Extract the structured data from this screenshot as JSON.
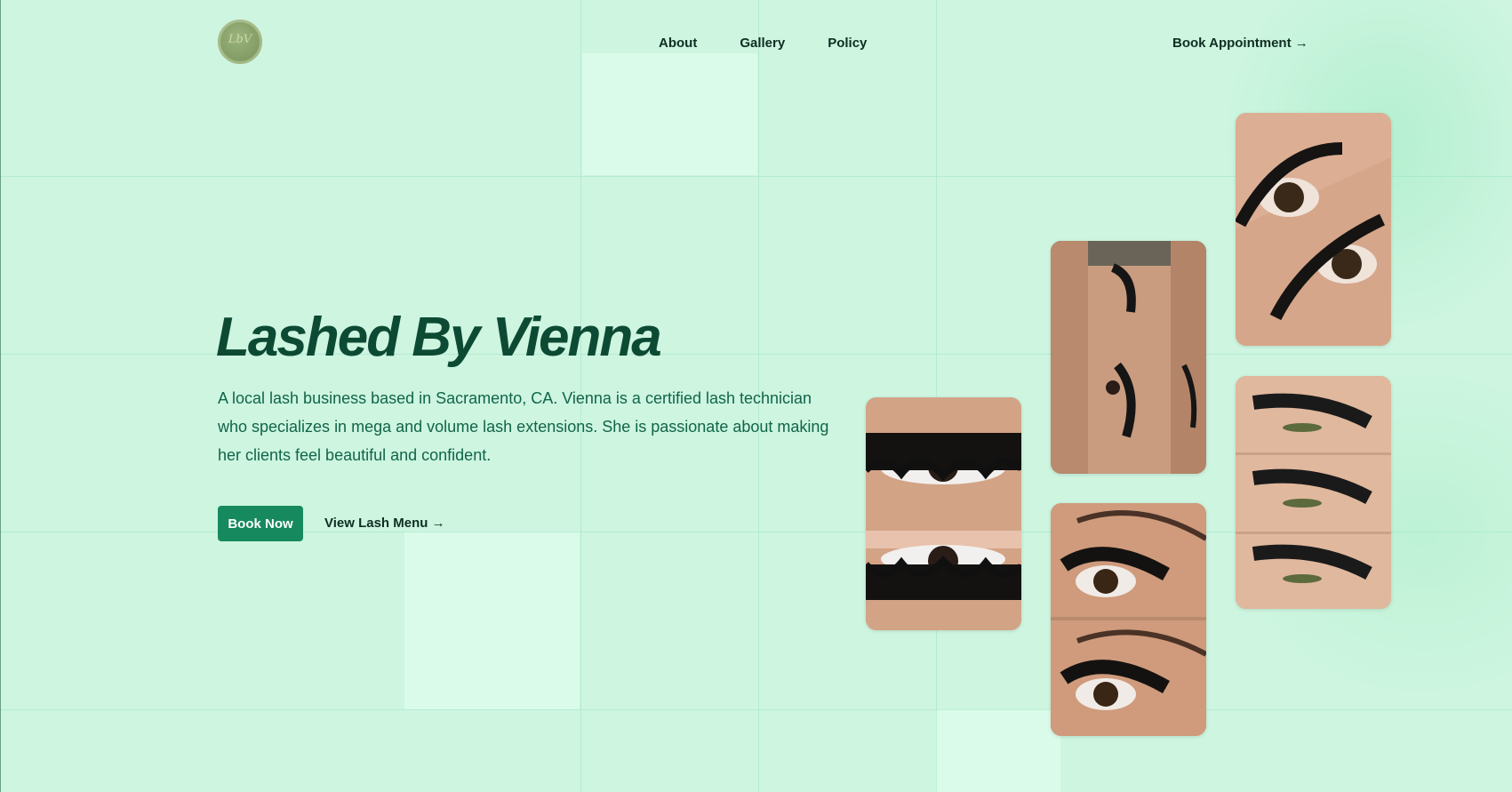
{
  "brand": {
    "logo_text": "LbV",
    "logo_icon": "circular-seal-logo"
  },
  "nav": {
    "items": [
      {
        "label": "About"
      },
      {
        "label": "Gallery"
      },
      {
        "label": "Policy"
      }
    ],
    "cta_label": "Book Appointment →"
  },
  "hero": {
    "title": "Lashed By Vienna",
    "description": "A local lash business based in Sacramento, CA. Vienna is a certified lash technician who specializes in mega and volume lash extensions. She is passionate about making her clients feel beautiful and confident.",
    "primary_button": "Book Now",
    "secondary_link": "View Lash Menu →"
  },
  "gallery": {
    "images": [
      {
        "subject": "lash-extensions-photo"
      },
      {
        "subject": "lash-extensions-photo"
      },
      {
        "subject": "lash-extensions-photo"
      },
      {
        "subject": "lash-extensions-photo"
      },
      {
        "subject": "lash-extensions-photo"
      }
    ]
  },
  "colors": {
    "background": "#cdf5e0",
    "title": "#0d4a34",
    "body_text": "#11654a",
    "button_bg": "#168a5e",
    "button_text": "#ffffff",
    "nav_text": "#0f2e22"
  }
}
